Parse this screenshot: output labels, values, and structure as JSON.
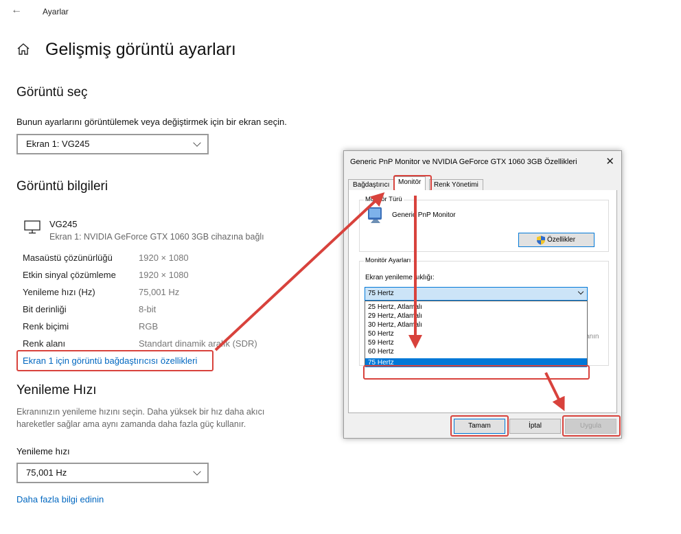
{
  "settings": {
    "app_title": "Ayarlar",
    "page_title": "Gelişmiş görüntü ayarları",
    "select_display": {
      "heading": "Görüntü seç",
      "description": "Bunun ayarlarını görüntülemek veya değiştirmek için bir ekran seçin.",
      "selected": "Ekran 1: VG245"
    },
    "display_info": {
      "heading": "Görüntü bilgileri",
      "monitor_name": "VG245",
      "monitor_sub": "Ekran 1: NVIDIA GeForce GTX 1060 3GB cihazına bağlı",
      "rows": [
        {
          "label": "Masaüstü çözünürlüğü",
          "value": "1920 × 1080"
        },
        {
          "label": "Etkin sinyal çözümleme",
          "value": "1920 × 1080"
        },
        {
          "label": "Yenileme hızı (Hz)",
          "value": "75,001 Hz"
        },
        {
          "label": "Bit derinliği",
          "value": "8-bit"
        },
        {
          "label": "Renk biçimi",
          "value": "RGB"
        },
        {
          "label": "Renk alanı",
          "value": "Standart dinamik aralık (SDR)"
        }
      ],
      "adapter_link": "Ekran 1 için görüntü bağdaştırıcısı özellikleri"
    },
    "refresh": {
      "heading": "Yenileme Hızı",
      "description_line1": "Ekranınızın yenileme hızını seçin. Daha yüksek bir hız daha akıcı",
      "description_line2": "hareketler sağlar ama aynı zamanda daha fazla güç kullanır.",
      "label": "Yenileme hızı",
      "selected": "75,001 Hz",
      "more_link": "Daha fazla bilgi edinin"
    }
  },
  "dialog": {
    "title": "Generic PnP Monitor ve NVIDIA GeForce GTX 1060 3GB Özellikleri",
    "close": "✕",
    "tabs": [
      "Bağdaştırıcı",
      "Monitör",
      "Renk Yönetimi"
    ],
    "monitor_type": {
      "label": "Monitör Türü",
      "name": "Generic PnP Monitor",
      "properties_button": "Özellikler"
    },
    "monitor_settings": {
      "label": "Monitör Ayarları",
      "refresh_label": "Ekran yenileme sıklığı:",
      "selected": "75 Hertz",
      "options": [
        "25 Hertz, Atlamalı",
        "29 Hertz, Atlamalı",
        "30 Hertz, Atlamalı",
        "50 Hertz",
        "59 Hertz",
        "60 Hertz",
        "75 Hertz"
      ],
      "hidden_text_fragment": "anın"
    },
    "buttons": {
      "ok": "Tamam",
      "cancel": "İptal",
      "apply": "Uygula"
    }
  },
  "colors": {
    "accent": "#0067c0",
    "highlight": "#d8423c",
    "selection": "#0078d7"
  }
}
